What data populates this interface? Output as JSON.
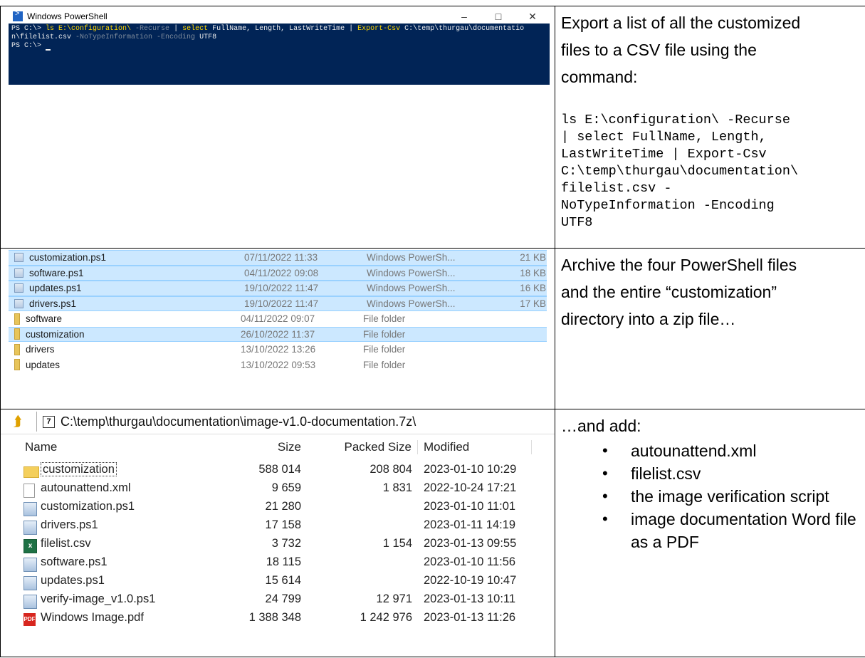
{
  "ps_window": {
    "title": "Windows PowerShell",
    "controls": [
      "–",
      "□",
      "✕"
    ],
    "line1_prompt": "PS C:\\> ",
    "line1_cmd": "ls E:\\configuration\\ ",
    "line1_param1": "-Recurse",
    "line1_pipe": " | ",
    "line1_select": "select",
    "line1_fields": " FullName, Length, LastWriteTime | ",
    "line1_export": "Export-Csv",
    "line1_path": " C:\\temp\\thurgau\\documentatio",
    "line2_path": "n\\filelist.csv ",
    "line2_param1": "-NoTypeInformation",
    "line2_param2": " -Encoding ",
    "line2_val": "UTF8",
    "line3_prompt": "PS C:\\> "
  },
  "row1_text": {
    "line1": "Export a list of all the customized",
    "line2": "files to a CSV file using the",
    "line3": "command:",
    "code": [
      "ls E:\\configuration\\ -Recurse",
      "| select FullName, Length,",
      "LastWriteTime | Export-Csv",
      "C:\\temp\\thurgau\\documentation\\",
      "filelist.csv -",
      "NoTypeInformation -Encoding",
      "UTF8"
    ]
  },
  "explorer": {
    "rows": [
      {
        "name": "customization.ps1",
        "date": "07/11/2022 11:33",
        "type": "Windows PowerSh...",
        "size": "21 KB"
      },
      {
        "name": "software.ps1",
        "date": "04/11/2022 09:08",
        "type": "Windows PowerSh...",
        "size": "18 KB"
      },
      {
        "name": "updates.ps1",
        "date": "19/10/2022 11:47",
        "type": "Windows PowerSh...",
        "size": "16 KB"
      },
      {
        "name": "drivers.ps1",
        "date": "19/10/2022 11:47",
        "type": "Windows PowerSh...",
        "size": "17 KB"
      },
      {
        "name": "software",
        "date": "04/11/2022 09:07",
        "type": "File folder",
        "size": ""
      },
      {
        "name": "customization",
        "date": "26/10/2022 11:37",
        "type": "File folder",
        "size": ""
      },
      {
        "name": "drivers",
        "date": "13/10/2022 13:26",
        "type": "File folder",
        "size": ""
      },
      {
        "name": "updates",
        "date": "13/10/2022 09:53",
        "type": "File folder",
        "size": ""
      }
    ]
  },
  "row2_text": {
    "line1": "Archive the four PowerShell files",
    "line2": "and the entire “customization”",
    "line3": "directory into a zip file…"
  },
  "zip": {
    "address": "C:\\temp\\thurgau\\documentation\\image-v1.0-documentation.7z\\",
    "headers": {
      "name": "Name",
      "size": "Size",
      "packed": "Packed Size",
      "modified": "Modified"
    },
    "rows": [
      {
        "name": "customization",
        "size": "588 014",
        "packed": "208 804",
        "modified": "2023-01-10 10:29"
      },
      {
        "name": "autounattend.xml",
        "size": "9 659",
        "packed": "1 831",
        "modified": "2022-10-24 17:21"
      },
      {
        "name": "customization.ps1",
        "size": "21 280",
        "packed": "",
        "modified": "2023-01-10 11:01"
      },
      {
        "name": "drivers.ps1",
        "size": "17 158",
        "packed": "",
        "modified": "2023-01-11 14:19"
      },
      {
        "name": "filelist.csv",
        "size": "3 732",
        "packed": "1 154",
        "modified": "2023-01-13 09:55"
      },
      {
        "name": "software.ps1",
        "size": "18 115",
        "packed": "",
        "modified": "2023-01-10 11:56"
      },
      {
        "name": "updates.ps1",
        "size": "15 614",
        "packed": "",
        "modified": "2022-10-19 10:47"
      },
      {
        "name": "verify-image_v1.0.ps1",
        "size": "24 799",
        "packed": "12 971",
        "modified": "2023-01-13 10:11"
      },
      {
        "name": "Windows Image.pdf",
        "size": "1 388 348",
        "packed": "1 242 976",
        "modified": "2023-01-13 11:26"
      }
    ]
  },
  "row3_text": {
    "intro": "…and add:",
    "bullets": [
      "autounattend.xml",
      "filelist.csv",
      "the image verification script",
      "image documentation Word file as a PDF"
    ]
  }
}
